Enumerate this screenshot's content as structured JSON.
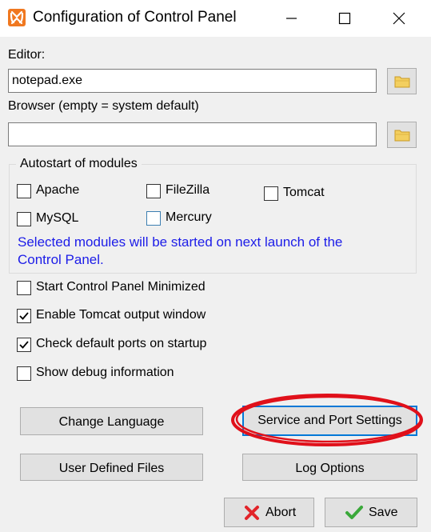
{
  "window": {
    "title": "Configuration of Control Panel",
    "icon": "xampp-logo-icon"
  },
  "editor": {
    "label": "Editor:",
    "value": "notepad.exe"
  },
  "browser": {
    "label": "Browser (empty = system default)",
    "value": ""
  },
  "autostart": {
    "title": "Autostart of modules",
    "modules": [
      {
        "label": "Apache",
        "checked": false
      },
      {
        "label": "FileZilla",
        "checked": false
      },
      {
        "label": "Tomcat",
        "checked": false
      },
      {
        "label": "MySQL",
        "checked": false
      },
      {
        "label": "Mercury",
        "checked": false
      }
    ],
    "info_line1": "Selected modules will be started on next launch of the",
    "info_line2": "Control Panel."
  },
  "options": [
    {
      "label": "Start Control Panel Minimized",
      "checked": false
    },
    {
      "label": "Enable Tomcat output window",
      "checked": true
    },
    {
      "label": "Check default ports on startup",
      "checked": true
    },
    {
      "label": "Show debug information",
      "checked": false
    }
  ],
  "buttons": {
    "change_language": "Change Language",
    "service_port_settings": "Service and Port Settings",
    "user_defined_files": "User Defined Files",
    "log_options": "Log Options",
    "abort": "Abort",
    "save": "Save"
  },
  "colors": {
    "info_text": "#1c1ce8",
    "highlight": "#e0101a",
    "focus": "#0078d7"
  }
}
